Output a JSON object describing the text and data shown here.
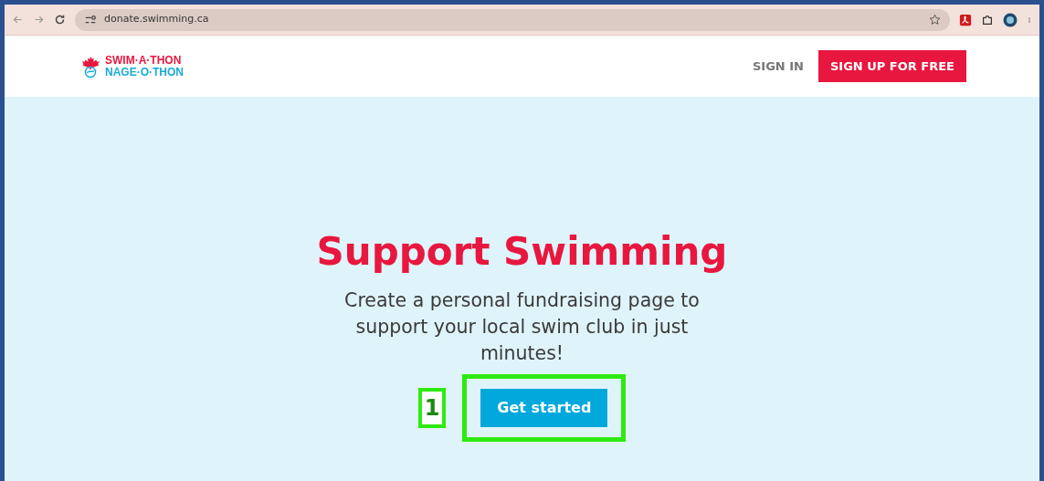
{
  "browser": {
    "url": "donate.swimming.ca"
  },
  "header": {
    "logo": {
      "line_1": "SWIM·A·THON",
      "line_2": "NAGE·O·THON"
    },
    "sign_in": "SIGN IN",
    "sign_up": "SIGN UP FOR FREE"
  },
  "hero": {
    "title": "Support Swimming",
    "text": "Create a personal fundraising page to support your local swim club in just minutes!",
    "button": "Get started"
  },
  "annotation": {
    "label": "1"
  }
}
